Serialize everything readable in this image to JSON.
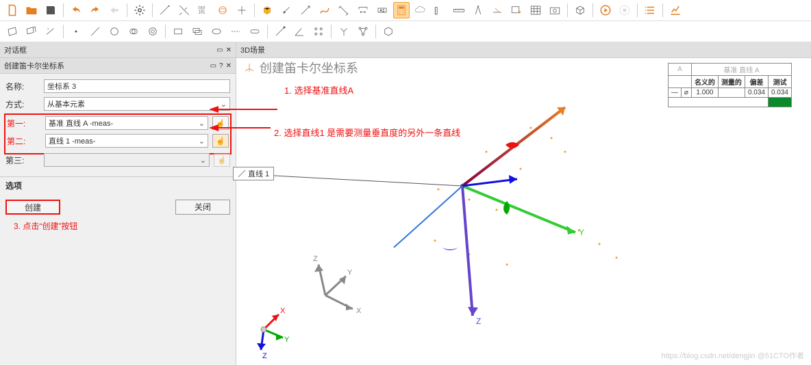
{
  "toolbar_icons_row1": [
    "new-file",
    "open-folder",
    "save",
    "sep",
    "undo",
    "redo",
    "forward",
    "sep",
    "settings",
    "sep",
    "edge",
    "surface",
    "matrix",
    "sphere",
    "axis",
    "sep",
    "cube",
    "axis2",
    "arrow",
    "curve",
    "dim-chain",
    "dim-auto",
    "gd-t-icon",
    "calc",
    "cloud",
    "ruler",
    "ruler2",
    "compass",
    "tol",
    "add-img",
    "table",
    "camera",
    "sep",
    "box3d",
    "sep",
    "play",
    "stop",
    "sep",
    "list",
    "sep",
    "chart"
  ],
  "toolbar_icons_row2": [
    "plane",
    "planes",
    "tilt",
    "sep",
    "point",
    "line",
    "circle",
    "overlap",
    "conc",
    "sep",
    "rect",
    "rect2",
    "ellipse",
    "dash",
    "slot",
    "sep",
    "line-pt",
    "angle",
    "pattern",
    "sep",
    "fork",
    "net",
    "sep",
    "cube2"
  ],
  "panels": {
    "dialog_title": "对话框",
    "create_title": "创建笛卡尔坐标系"
  },
  "form": {
    "name_label": "名称:",
    "name_value": "坐标系 3",
    "method_label": "方式:",
    "method_value": "从基本元素",
    "first_label": "第一:",
    "first_value": "基准 直线 A -meas-",
    "second_label": "第二:",
    "second_value": "直线 1 -meas-",
    "third_label": "第三:",
    "third_value": "",
    "options_label": "选项",
    "create_btn": "创建",
    "close_btn": "关闭"
  },
  "annotations": {
    "a1": "1. 选择基准直线A",
    "a2": "2. 选择直线1 是需要测量垂直度的另外一条直线",
    "a3": "3. 点击“创建”按钮"
  },
  "scene": {
    "title": "3D场景",
    "header": "创建笛卡尔坐标系",
    "line_label": "直线 1",
    "ref_label": "基准 直线 A",
    "axis_Y": "Y",
    "axis_Z": "Z",
    "axis_X": "X"
  },
  "meas": {
    "col1": "名义的",
    "col2": "测量的",
    "col3": "偏差",
    "col4": "测试",
    "sym": "⌀",
    "nominal": "1.000",
    "measured": "",
    "dev": "0.034",
    "dev2": "0.034"
  },
  "watermark": "https://blog.csdn.net/dengjin @51CTO作者"
}
